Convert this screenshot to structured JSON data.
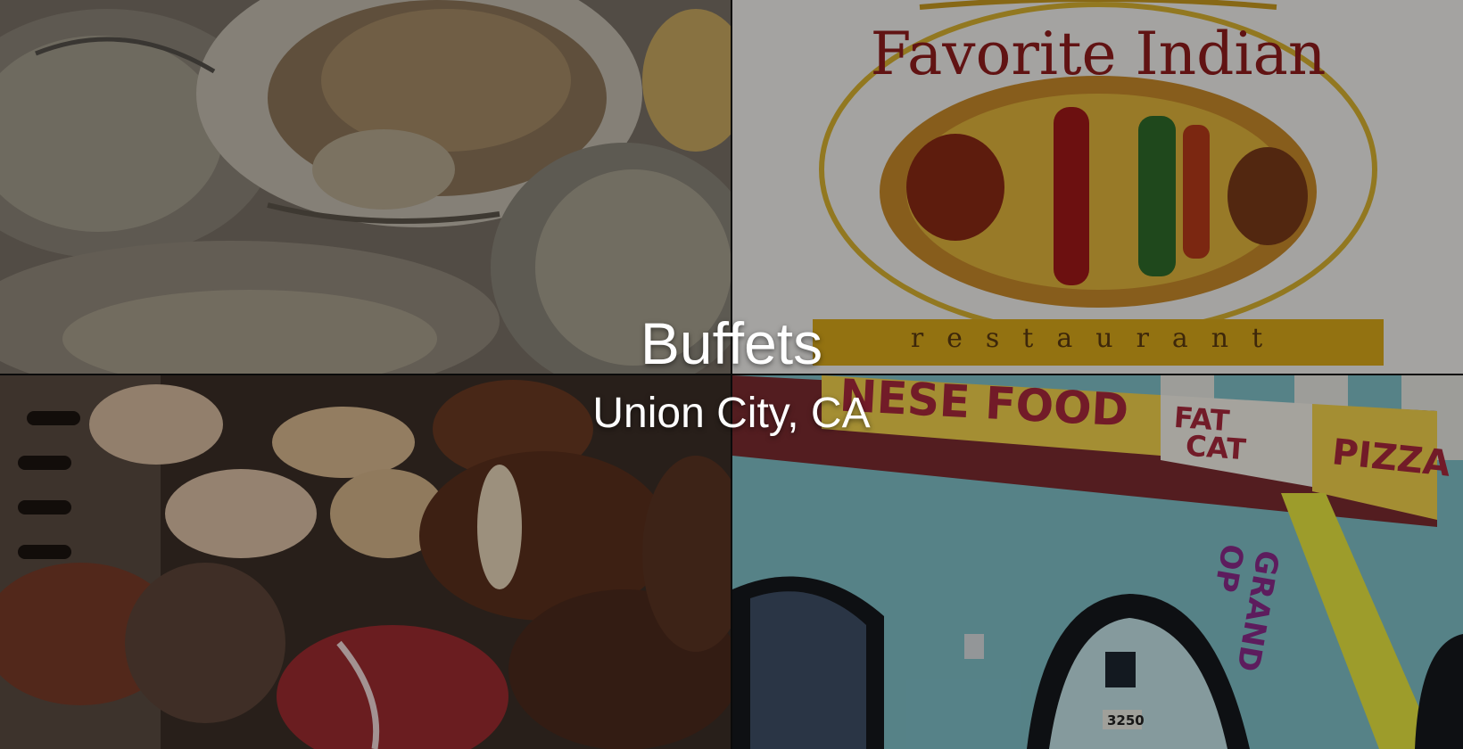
{
  "hero": {
    "title": "Buffets",
    "subtitle": "Union City, CA"
  },
  "tiles": {
    "indian_logo": {
      "name": "Favorite Indian",
      "tagline": "restaurant"
    },
    "storefront": {
      "banner_left": "NESE FOOD",
      "banner_mid_1": "FAT",
      "banner_mid_2": "CAT",
      "banner_right": "PIZZA",
      "flag_text": "GRAND OP",
      "address_number": "3250"
    }
  }
}
